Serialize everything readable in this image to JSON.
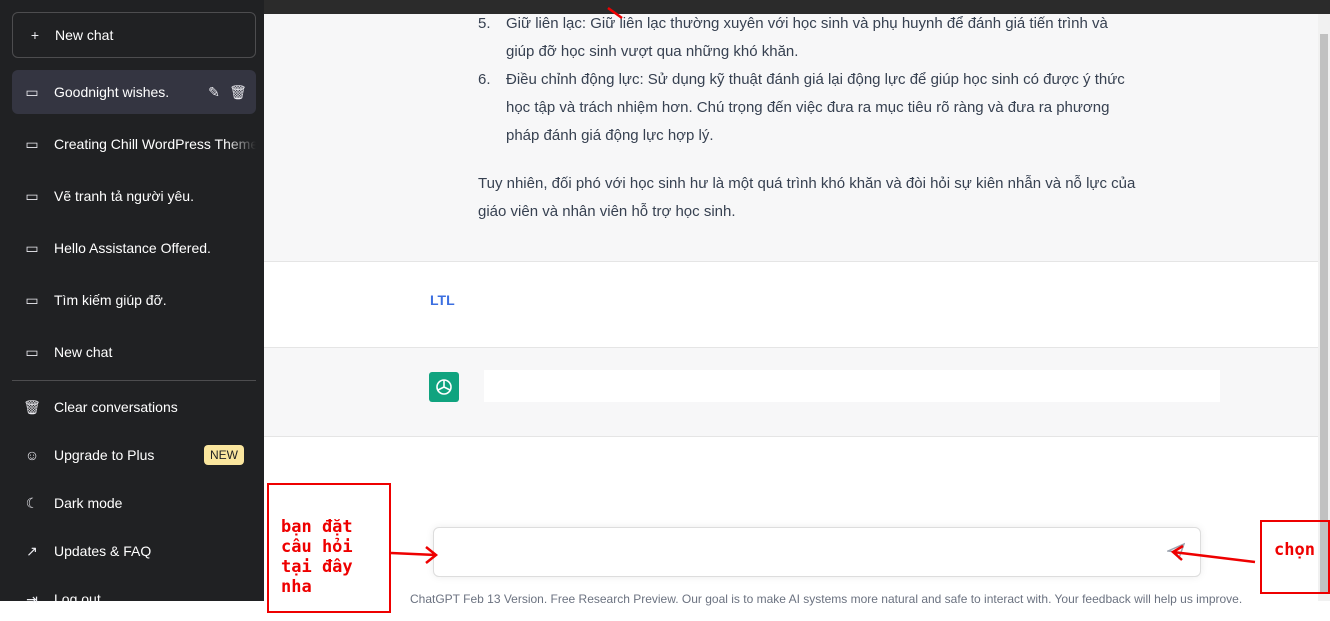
{
  "sidebar": {
    "new_chat": "New chat",
    "history": [
      "Goodnight wishes.",
      "Creating Chill WordPress Theme",
      "Vẽ tranh tả người yêu.",
      "Hello Assistance Offered.",
      "Tìm kiếm giúp đỡ.",
      "New chat"
    ],
    "menu": {
      "clear": "Clear conversations",
      "upgrade": "Upgrade to Plus",
      "upgrade_badge": "NEW",
      "dark": "Dark mode",
      "updates": "Updates & FAQ",
      "logout": "Log out"
    }
  },
  "conversation": {
    "items": [
      {
        "n": "5.",
        "text": "Giữ liên lạc: Giữ liên lạc thường xuyên với học sinh và phụ huynh để đánh giá tiến trình và giúp đỡ học sinh vượt qua những khó khăn."
      },
      {
        "n": "6.",
        "text": "Điều chỉnh động lực: Sử dụng kỹ thuật đánh giá lại động lực để giúp học sinh có được ý thức học tập và trách nhiệm hơn. Chú trọng đến việc đưa ra mục tiêu rõ ràng và đưa ra phương pháp đánh giá động lực hợp lý."
      }
    ],
    "closing": "Tuy nhiên, đối phó với học sinh hư là một quá trình khó khăn và đòi hỏi sự kiên nhẫn và nỗ lực của giáo viên và nhân viên hỗ trợ học sinh.",
    "user_avatar": "LTL"
  },
  "composer": {
    "value": "",
    "footer": "ChatGPT Feb 13 Version. Free Research Preview. Our goal is to make AI systems more natural and safe to interact with. Your feedback will help us improve."
  },
  "annotations": {
    "left": "bạn đặt câu hỏi tại đây nha",
    "right": "chọn"
  },
  "colors": {
    "sidebar": "#202123",
    "accent": "#10a37f",
    "annotation": "#ee0000"
  }
}
